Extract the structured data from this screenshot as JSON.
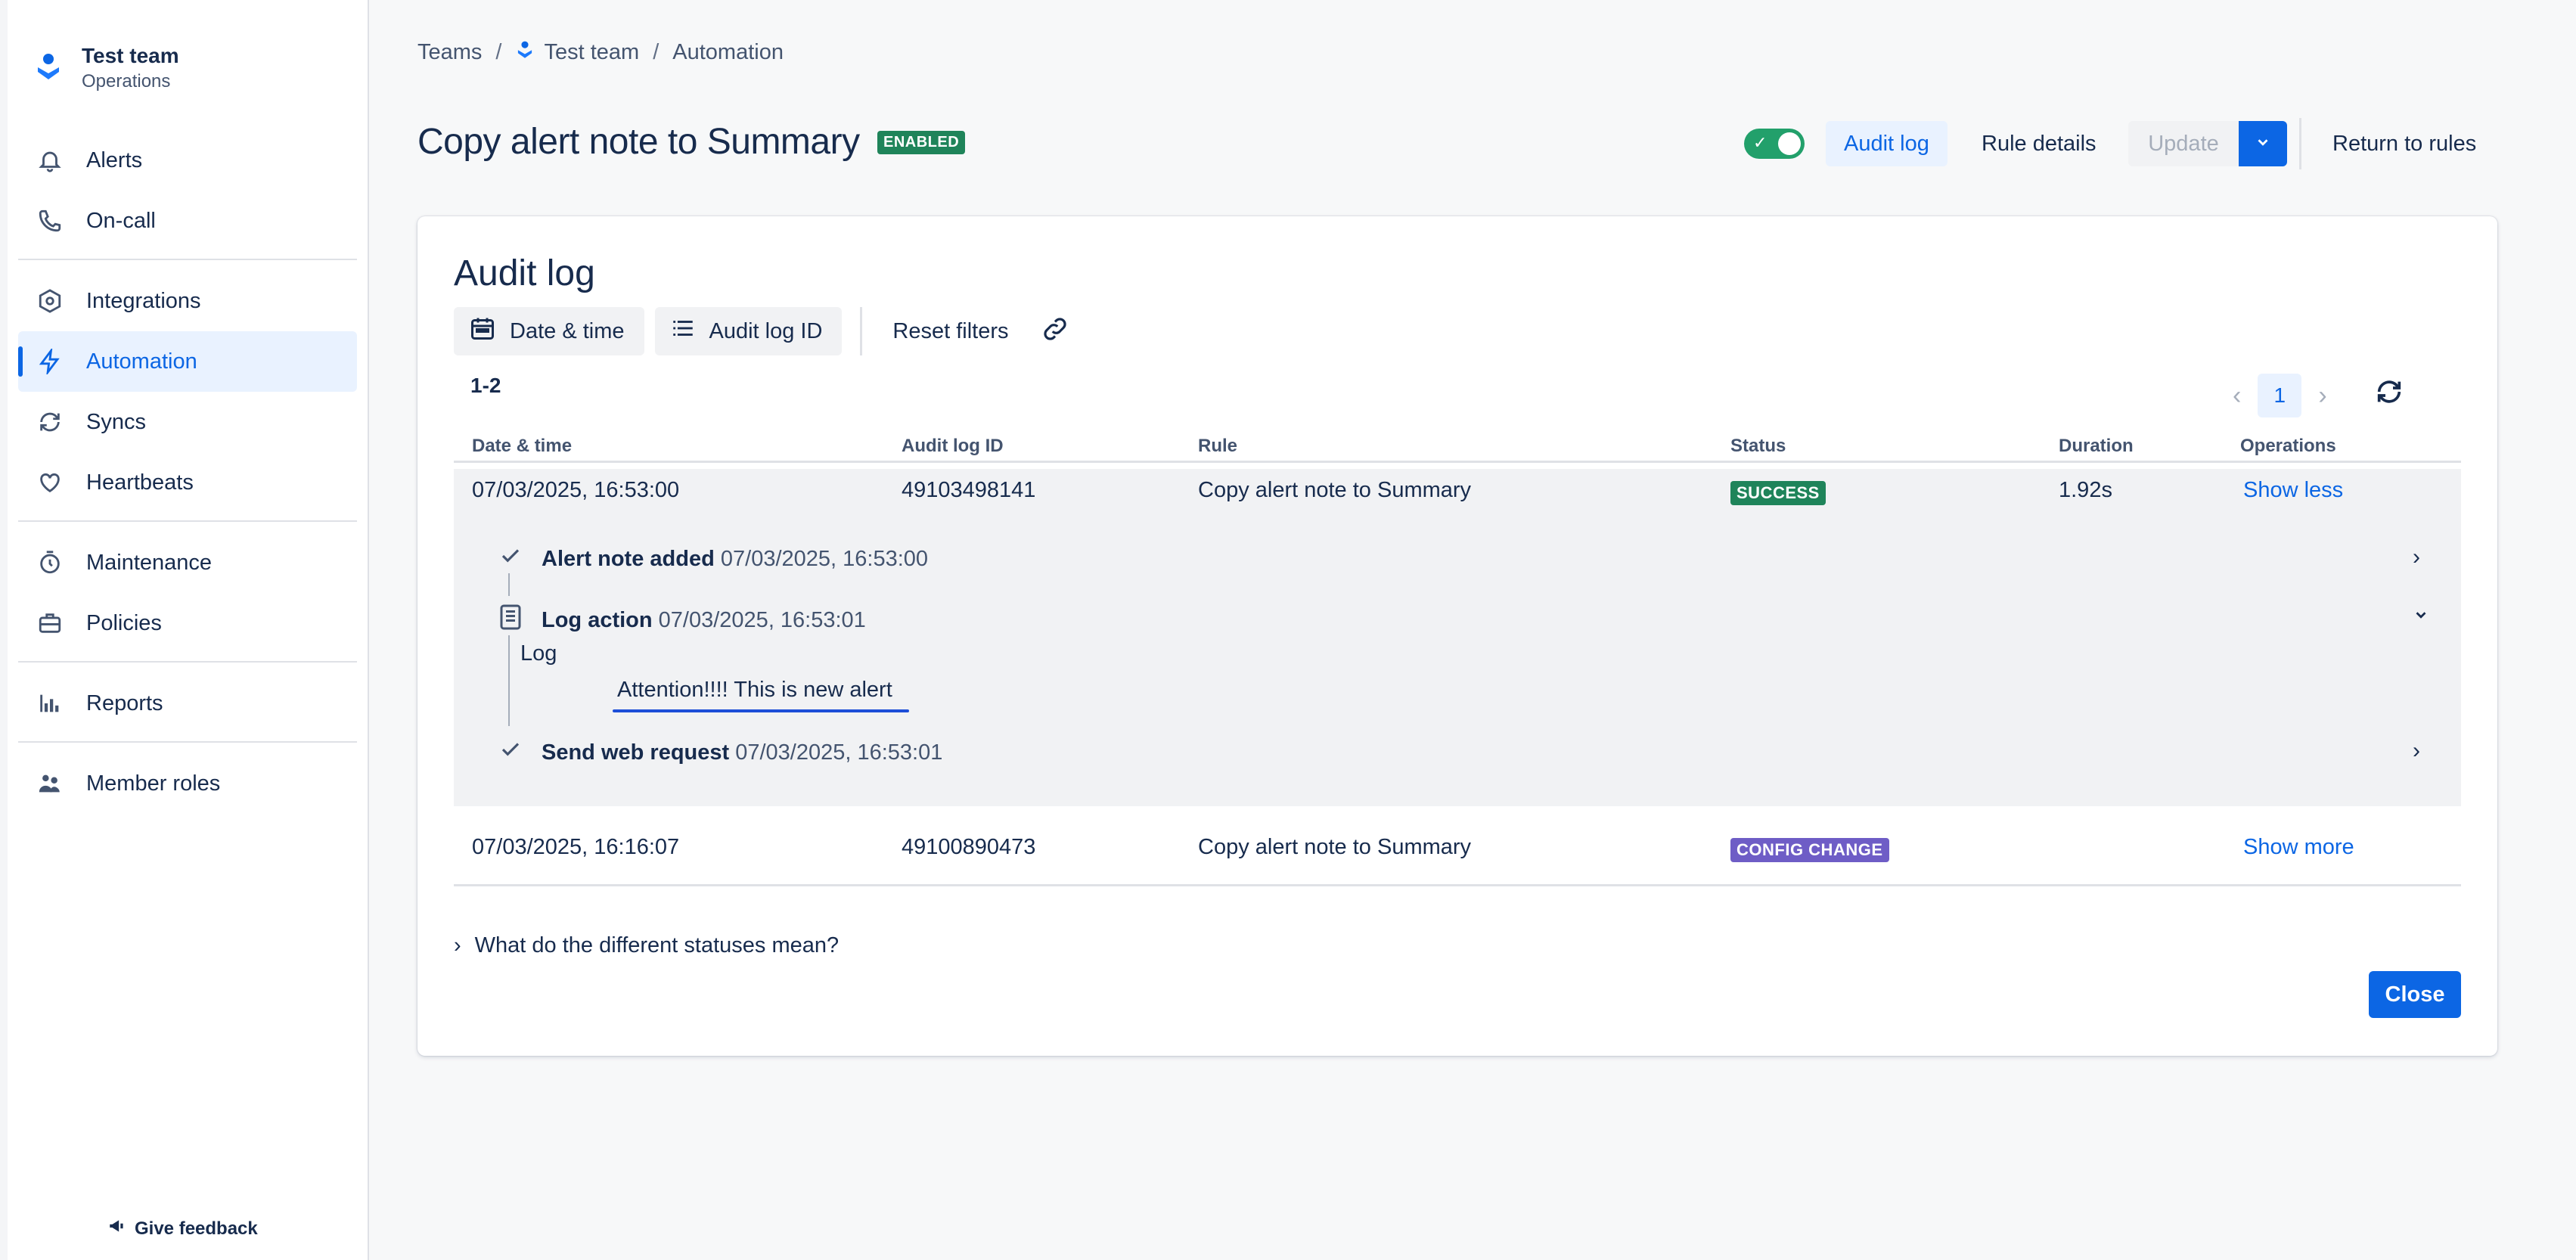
{
  "sidebar": {
    "team_name": "Test team",
    "team_sub": "Operations",
    "items": [
      {
        "label": "Alerts",
        "icon": "bell-icon"
      },
      {
        "label": "On-call",
        "icon": "phone-icon"
      },
      {
        "label": "Integrations",
        "icon": "hexagon-icon"
      },
      {
        "label": "Automation",
        "icon": "bolt-icon",
        "active": true
      },
      {
        "label": "Syncs",
        "icon": "sync-icon"
      },
      {
        "label": "Heartbeats",
        "icon": "heart-icon"
      },
      {
        "label": "Maintenance",
        "icon": "stopwatch-icon"
      },
      {
        "label": "Policies",
        "icon": "briefcase-icon"
      },
      {
        "label": "Reports",
        "icon": "bar-chart-icon"
      },
      {
        "label": "Member roles",
        "icon": "people-icon"
      }
    ],
    "feedback": "Give feedback"
  },
  "breadcrumb": [
    "Teams",
    "Test team",
    "Automation"
  ],
  "header": {
    "title": "Copy alert note to Summary",
    "status_badge": "ENABLED",
    "audit_log": "Audit log",
    "rule_details": "Rule details",
    "update": "Update",
    "return": "Return to rules"
  },
  "audit": {
    "title": "Audit log",
    "filters": {
      "date_time": "Date & time",
      "audit_id": "Audit log ID",
      "reset": "Reset filters"
    },
    "range": "1-2",
    "page": "1",
    "columns": [
      "Date & time",
      "Audit log ID",
      "Rule",
      "Status",
      "Duration",
      "Operations"
    ],
    "rows": [
      {
        "date": "07/03/2025, 16:53:00",
        "id": "49103498141",
        "rule": "Copy alert note to Summary",
        "status": "SUCCESS",
        "duration": "1.92s",
        "op": "Show less"
      },
      {
        "date": "07/03/2025, 16:16:07",
        "id": "49100890473",
        "rule": "Copy alert note to Summary",
        "status": "CONFIG CHANGE",
        "duration": "",
        "op": "Show more"
      }
    ],
    "steps": [
      {
        "title": "Alert note added",
        "time": "07/03/2025, 16:53:00"
      },
      {
        "title": "Log action",
        "time": "07/03/2025, 16:53:01"
      },
      {
        "title": "Send web request",
        "time": "07/03/2025, 16:53:01"
      }
    ],
    "log_label": "Log",
    "log_message": "Attention!!!! This is new alert",
    "statuses_help": "What do the different statuses mean?",
    "close": "Close"
  },
  "colors": {
    "brand": "#0c66e4",
    "success": "#1f845a",
    "config": "#6e5dc6"
  }
}
